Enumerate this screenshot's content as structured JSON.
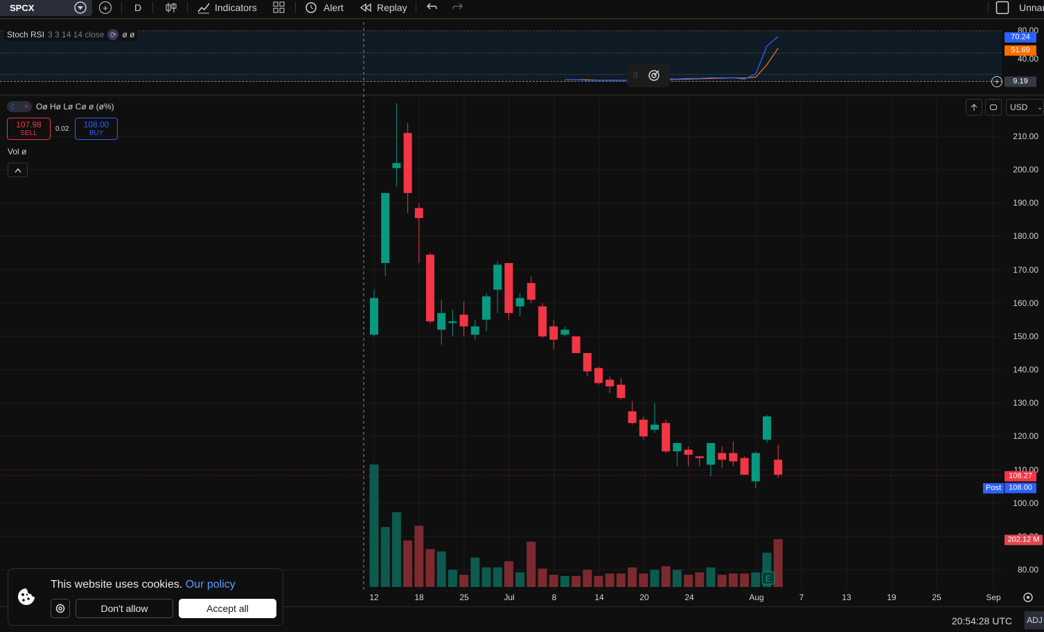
{
  "toolbar": {
    "symbol": "SPCX",
    "interval": "D",
    "indicators_label": "Indicators",
    "alert_label": "Alert",
    "replay_label": "Replay",
    "layout_name": "Unnar"
  },
  "stoch_rsi": {
    "name": "Stoch RSI",
    "params": "3 3 14 14 close",
    "values": "ø ø",
    "scale_labels": [
      "80.00",
      "40.00"
    ],
    "k_value": "70.24",
    "d_value": "51.69",
    "crosshair_value": "9.19",
    "k_color": "#2962ff",
    "d_color": "#ff6d00"
  },
  "legend": {
    "ohlc": "Oø Hø Lø Cø ø (ø%)",
    "sell_price": "107.98",
    "sell_label": "SELL",
    "spread": "0.02",
    "buy_price": "108.00",
    "buy_label": "BUY",
    "volume": "Vol  ø"
  },
  "price_scale": {
    "currency": "USD",
    "labels": [
      "210.00",
      "200.00",
      "190.00",
      "180.00",
      "170.00",
      "160.00",
      "150.00",
      "140.00",
      "130.00",
      "120.00",
      "110.00",
      "100.00",
      "90.00",
      "80.00"
    ],
    "last_price": "108.27",
    "post_label": "Post",
    "post_price": "108.00",
    "volume_badge": "202.12 M",
    "last_color": "#f23645",
    "post_color": "#2962ff"
  },
  "time_axis": {
    "labels": [
      "12",
      "18",
      "25",
      "Jul",
      "8",
      "14",
      "20",
      "24",
      "Aug",
      "7",
      "13",
      "19",
      "25",
      "Sep"
    ]
  },
  "status": {
    "clock": "20:54:28 UTC",
    "adj": "ADJ"
  },
  "cookie": {
    "text": "This website uses cookies.",
    "link": "Our policy",
    "dont_allow": "Don't allow",
    "accept_all": "Accept all"
  },
  "chart_data": {
    "type": "candlestick",
    "up_color": "#089981",
    "down_color": "#f23645",
    "ylim": [
      76,
      218
    ],
    "candles": [
      {
        "o": 150.5,
        "h": 164,
        "l": 150,
        "c": 161.5
      },
      {
        "o": 172,
        "h": 193,
        "l": 168,
        "c": 193
      },
      {
        "o": 200.5,
        "h": 220,
        "l": 195,
        "c": 202
      },
      {
        "o": 211,
        "h": 214,
        "l": 187,
        "c": 193
      },
      {
        "o": 188.5,
        "h": 190,
        "l": 172,
        "c": 185.5
      },
      {
        "o": 174.5,
        "h": 175,
        "l": 154,
        "c": 154.5
      },
      {
        "o": 152,
        "h": 161,
        "l": 147.5,
        "c": 157
      },
      {
        "o": 154,
        "h": 158,
        "l": 150,
        "c": 154.5
      },
      {
        "o": 156.5,
        "h": 160.5,
        "l": 150,
        "c": 153
      },
      {
        "o": 150.5,
        "h": 155,
        "l": 149,
        "c": 153
      },
      {
        "o": 155,
        "h": 163,
        "l": 151.5,
        "c": 162
      },
      {
        "o": 164,
        "h": 172.5,
        "l": 157,
        "c": 171.5
      },
      {
        "o": 172,
        "h": 172,
        "l": 155,
        "c": 157
      },
      {
        "o": 159,
        "h": 163,
        "l": 156,
        "c": 161.5
      },
      {
        "o": 166,
        "h": 168,
        "l": 160,
        "c": 161
      },
      {
        "o": 159,
        "h": 160,
        "l": 149.5,
        "c": 150
      },
      {
        "o": 153,
        "h": 155,
        "l": 146,
        "c": 149
      },
      {
        "o": 150.5,
        "h": 153,
        "l": 150,
        "c": 152
      },
      {
        "o": 150,
        "h": 150,
        "l": 145,
        "c": 145
      },
      {
        "o": 145,
        "h": 145,
        "l": 138,
        "c": 139.5
      },
      {
        "o": 140.5,
        "h": 141,
        "l": 135.5,
        "c": 136
      },
      {
        "o": 137,
        "h": 138,
        "l": 133,
        "c": 135
      },
      {
        "o": 135.5,
        "h": 137.5,
        "l": 131,
        "c": 131.5
      },
      {
        "o": 127.5,
        "h": 130.5,
        "l": 123.5,
        "c": 124
      },
      {
        "o": 125,
        "h": 126,
        "l": 119,
        "c": 120
      },
      {
        "o": 122,
        "h": 130,
        "l": 121,
        "c": 123.5
      },
      {
        "o": 124,
        "h": 125,
        "l": 115,
        "c": 115.5
      },
      {
        "o": 115.5,
        "h": 118,
        "l": 111,
        "c": 118
      },
      {
        "o": 116,
        "h": 117,
        "l": 111,
        "c": 114.5
      },
      {
        "o": 114,
        "h": 114,
        "l": 111,
        "c": 113.5
      },
      {
        "o": 111.5,
        "h": 118,
        "l": 108,
        "c": 118
      },
      {
        "o": 115,
        "h": 117,
        "l": 110.5,
        "c": 113
      },
      {
        "o": 115,
        "h": 118.5,
        "l": 111,
        "c": 112.5
      },
      {
        "o": 113.5,
        "h": 114,
        "l": 108.5,
        "c": 108.5
      },
      {
        "o": 106.5,
        "h": 115.5,
        "l": 104.5,
        "c": 115
      },
      {
        "o": 119,
        "h": 126.5,
        "l": 118,
        "c": 126
      },
      {
        "o": 113,
        "h": 117.5,
        "l": 107.5,
        "c": 108.5
      }
    ],
    "volume_relative": [
      1.0,
      0.49,
      0.61,
      0.38,
      0.5,
      0.31,
      0.29,
      0.14,
      0.1,
      0.24,
      0.16,
      0.16,
      0.21,
      0.12,
      0.37,
      0.15,
      0.1,
      0.09,
      0.09,
      0.14,
      0.09,
      0.11,
      0.11,
      0.16,
      0.11,
      0.14,
      0.17,
      0.14,
      0.1,
      0.12,
      0.16,
      0.1,
      0.11,
      0.11,
      0.12,
      0.28,
      0.39
    ],
    "stoch_k": [
      null,
      null,
      null,
      null,
      null,
      null,
      null,
      null,
      null,
      null,
      null,
      null,
      null,
      null,
      null,
      null,
      null,
      1,
      1,
      0,
      0,
      0,
      0,
      0,
      0,
      1,
      2,
      2,
      3,
      3,
      4,
      4,
      4,
      2,
      10,
      55,
      70.24
    ],
    "stoch_d": [
      null,
      null,
      null,
      null,
      null,
      null,
      null,
      null,
      null,
      null,
      null,
      null,
      null,
      null,
      null,
      null,
      null,
      1,
      1,
      1,
      0,
      0,
      0,
      0,
      0,
      0.5,
      1,
      1.5,
      2,
      2.5,
      3,
      3.5,
      4,
      3.5,
      5,
      25,
      51.69
    ]
  }
}
